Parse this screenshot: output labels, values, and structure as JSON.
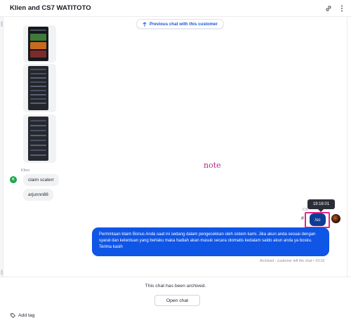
{
  "header": {
    "title": "Klien and CS7 WATITOTO"
  },
  "icons": {
    "link": "link-icon",
    "more": "more-vertical-icon",
    "arrow_up": "arrow-up-icon",
    "tag": "tag-icon"
  },
  "conversation": {
    "previous_chat_label": "Previous chat with this customer",
    "customer": {
      "sender_name": "Klien",
      "avatar_initial": "K",
      "messages": [
        "claim scaterr",
        "arjunnn88"
      ]
    },
    "annotation_note": "note",
    "agent": {
      "tooltip_time": "19:16:01",
      "partial_name": "CS",
      "short_message": "/sc",
      "message": "Permintaan klaim Bonus Anda saat ini sedang dalam pengecekkan oleh sistem kami. Jika akun anda sesuai dengan syarat dan ketentuan yang berlaku maka hadiah akan masuk secara otomatis kedalam saldo akun anda ya bosku. Terima kasih",
      "hash_mark": "#"
    },
    "archived_meta": "Archived - customer left the chat • 19:18"
  },
  "footer": {
    "archived_text": "This chat has been archived.",
    "open_chat_label": "Open chat",
    "add_tag_label": "Add tag"
  },
  "colors": {
    "accent_blue": "#0f55e6",
    "agent_bubble_dark": "#0f3d94",
    "link_blue": "#1b55d8",
    "highlight_pink": "#e2248c",
    "note_magenta": "#c0228b",
    "customer_avatar": "#1aa84b"
  }
}
